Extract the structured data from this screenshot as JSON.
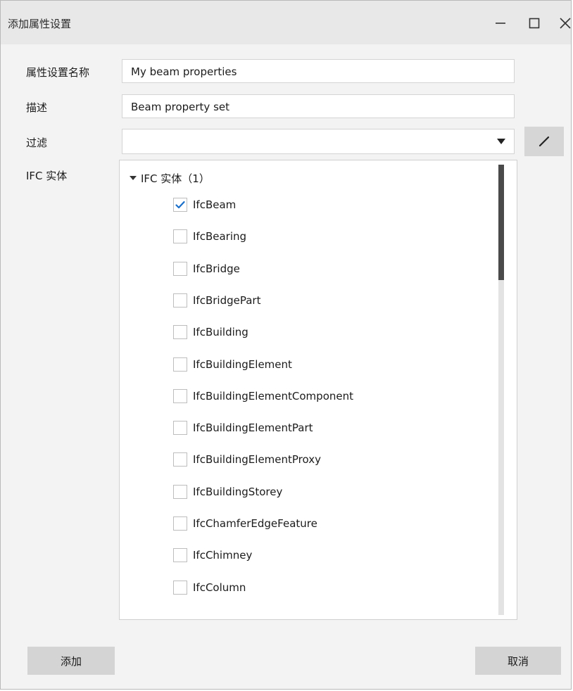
{
  "window": {
    "title": "添加属性设置"
  },
  "form": {
    "name_label": "属性设置名称",
    "name_value": "My beam properties",
    "description_label": "描述",
    "description_value": "Beam property set",
    "filter_label": "过滤",
    "filter_value": "",
    "ifc_label": "IFC 实体"
  },
  "tree": {
    "root_label": "IFC 实体（1）",
    "items": [
      {
        "label": "IfcBeam",
        "checked": true
      },
      {
        "label": "IfcBearing",
        "checked": false
      },
      {
        "label": "IfcBridge",
        "checked": false
      },
      {
        "label": "IfcBridgePart",
        "checked": false
      },
      {
        "label": "IfcBuilding",
        "checked": false
      },
      {
        "label": "IfcBuildingElement",
        "checked": false
      },
      {
        "label": "IfcBuildingElementComponent",
        "checked": false
      },
      {
        "label": "IfcBuildingElementPart",
        "checked": false
      },
      {
        "label": "IfcBuildingElementProxy",
        "checked": false
      },
      {
        "label": "IfcBuildingStorey",
        "checked": false
      },
      {
        "label": "IfcChamferEdgeFeature",
        "checked": false
      },
      {
        "label": "IfcChimney",
        "checked": false
      },
      {
        "label": "IfcColumn",
        "checked": false
      }
    ]
  },
  "footer": {
    "add_label": "添加",
    "cancel_label": "取消"
  },
  "colors": {
    "check_accent": "#1a6fc9",
    "button_bg": "#d4d4d4",
    "titlebar_bg": "#e8e8e8"
  }
}
